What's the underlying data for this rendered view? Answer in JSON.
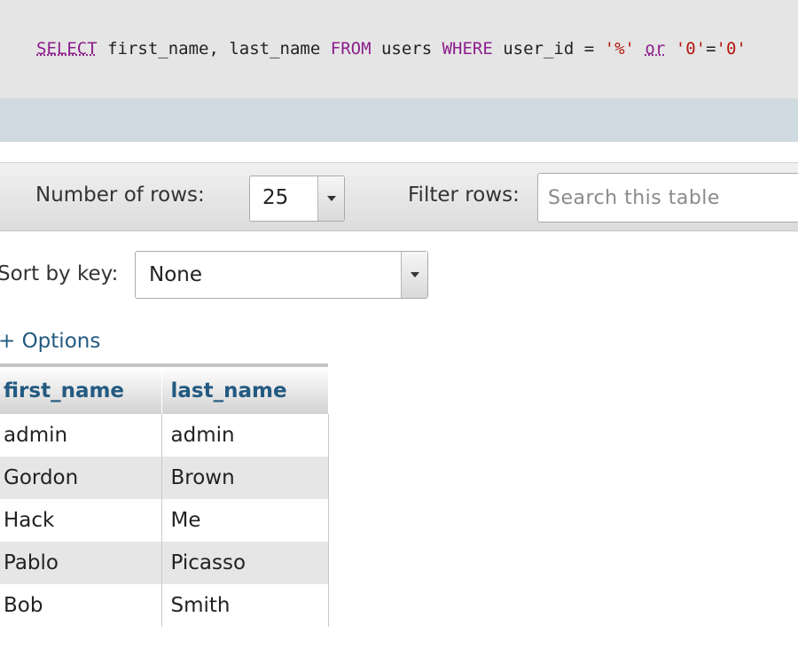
{
  "sql": {
    "tokens": [
      {
        "text": "SELECT",
        "type": "kw-first"
      },
      {
        "text": " first_name, last_name ",
        "type": "plain"
      },
      {
        "text": "FROM",
        "type": "kw"
      },
      {
        "text": " users ",
        "type": "plain"
      },
      {
        "text": "WHERE",
        "type": "kw"
      },
      {
        "text": " user_id = ",
        "type": "plain"
      },
      {
        "text": "'%'",
        "type": "str"
      },
      {
        "text": " ",
        "type": "plain"
      },
      {
        "text": "or",
        "type": "kw-first"
      },
      {
        "text": " ",
        "type": "plain"
      },
      {
        "text": "'0'",
        "type": "str"
      },
      {
        "text": "=",
        "type": "plain"
      },
      {
        "text": "'0'",
        "type": "str"
      }
    ]
  },
  "toolbar": {
    "rows_label": "Number of rows:",
    "rows_value": "25",
    "filter_label": "Filter rows:",
    "filter_placeholder": "Search this table",
    "filter_value": ""
  },
  "sort": {
    "label": "Sort by key:",
    "value": "None"
  },
  "options_link": "+ Options",
  "table": {
    "columns": [
      "first_name",
      "last_name"
    ],
    "rows": [
      [
        "admin",
        "admin"
      ],
      [
        "Gordon",
        "Brown"
      ],
      [
        "Hack",
        "Me"
      ],
      [
        "Pablo",
        "Picasso"
      ],
      [
        "Bob",
        "Smith"
      ]
    ]
  },
  "colors": {
    "keyword": "#8c1f8c",
    "string": "#b3160f",
    "link": "#235a81"
  },
  "icons": {
    "dropdown": "chevron-down-icon"
  }
}
